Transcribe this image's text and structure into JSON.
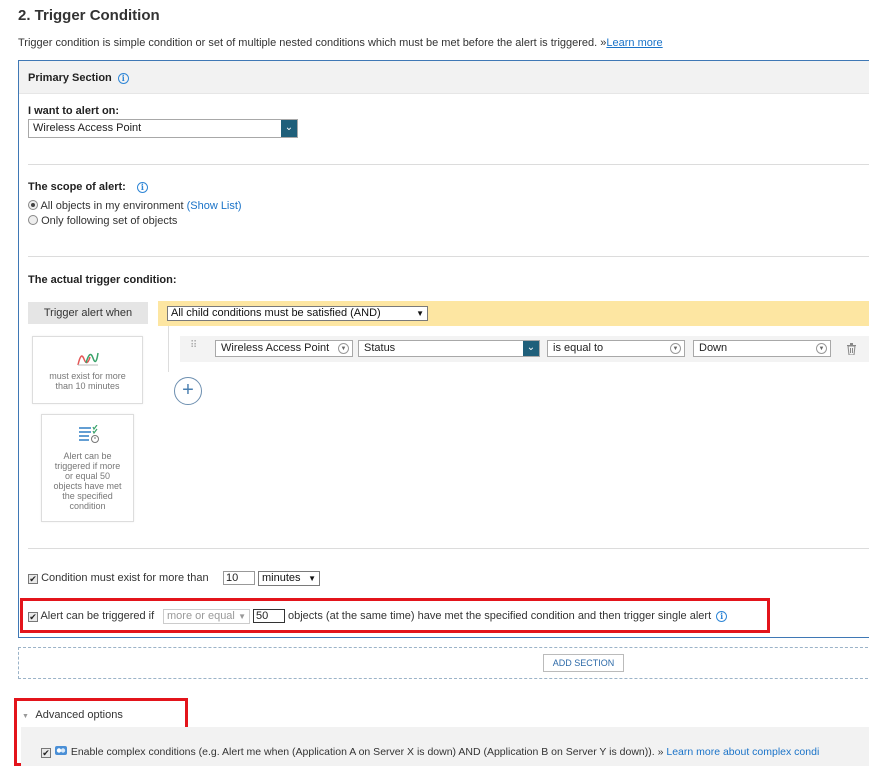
{
  "section": {
    "title": "2. Trigger Condition",
    "description": "Trigger condition is simple condition or set of multiple nested conditions which must be met before the alert is triggered. »",
    "learn_more": "Learn more"
  },
  "primary": {
    "title": "Primary Section",
    "alert_on_label": "I want to alert on:",
    "alert_on_value": "Wireless Access Point",
    "scope_label": "The scope of alert:",
    "scope_all": "All objects in my environment",
    "show_list": "(Show List)",
    "scope_following": "Only following set of objects",
    "actual_trigger_label": "The actual trigger condition:",
    "trigger_when": "Trigger alert when",
    "group_condition": "All child conditions must be satisfied (AND)",
    "condition": {
      "object": "Wireless Access Point",
      "field": "Status",
      "operator": "is equal to",
      "value": "Down"
    },
    "side_box_time": "must exist for more than 10 minutes",
    "side_box_count": "Alert can be triggered if more or equal 50 objects have met the specified condition",
    "cond_exist_label": "Condition must exist for more than",
    "cond_exist_value": "10",
    "cond_exist_unit": "minutes",
    "alert_trigger_prefix": "Alert can be triggered if",
    "alert_trigger_op": "more or equal",
    "alert_trigger_count": "50",
    "alert_trigger_suffix": "objects (at the same time) have met the specified condition and then trigger single alert"
  },
  "add_section": "ADD SECTION",
  "advanced": {
    "title": "Advanced options",
    "complex_label": "Enable complex conditions (e.g. Alert me when (Application A on Server X is down) AND (Application B on Server Y is down)). »",
    "complex_link": "Learn more about complex condi"
  }
}
